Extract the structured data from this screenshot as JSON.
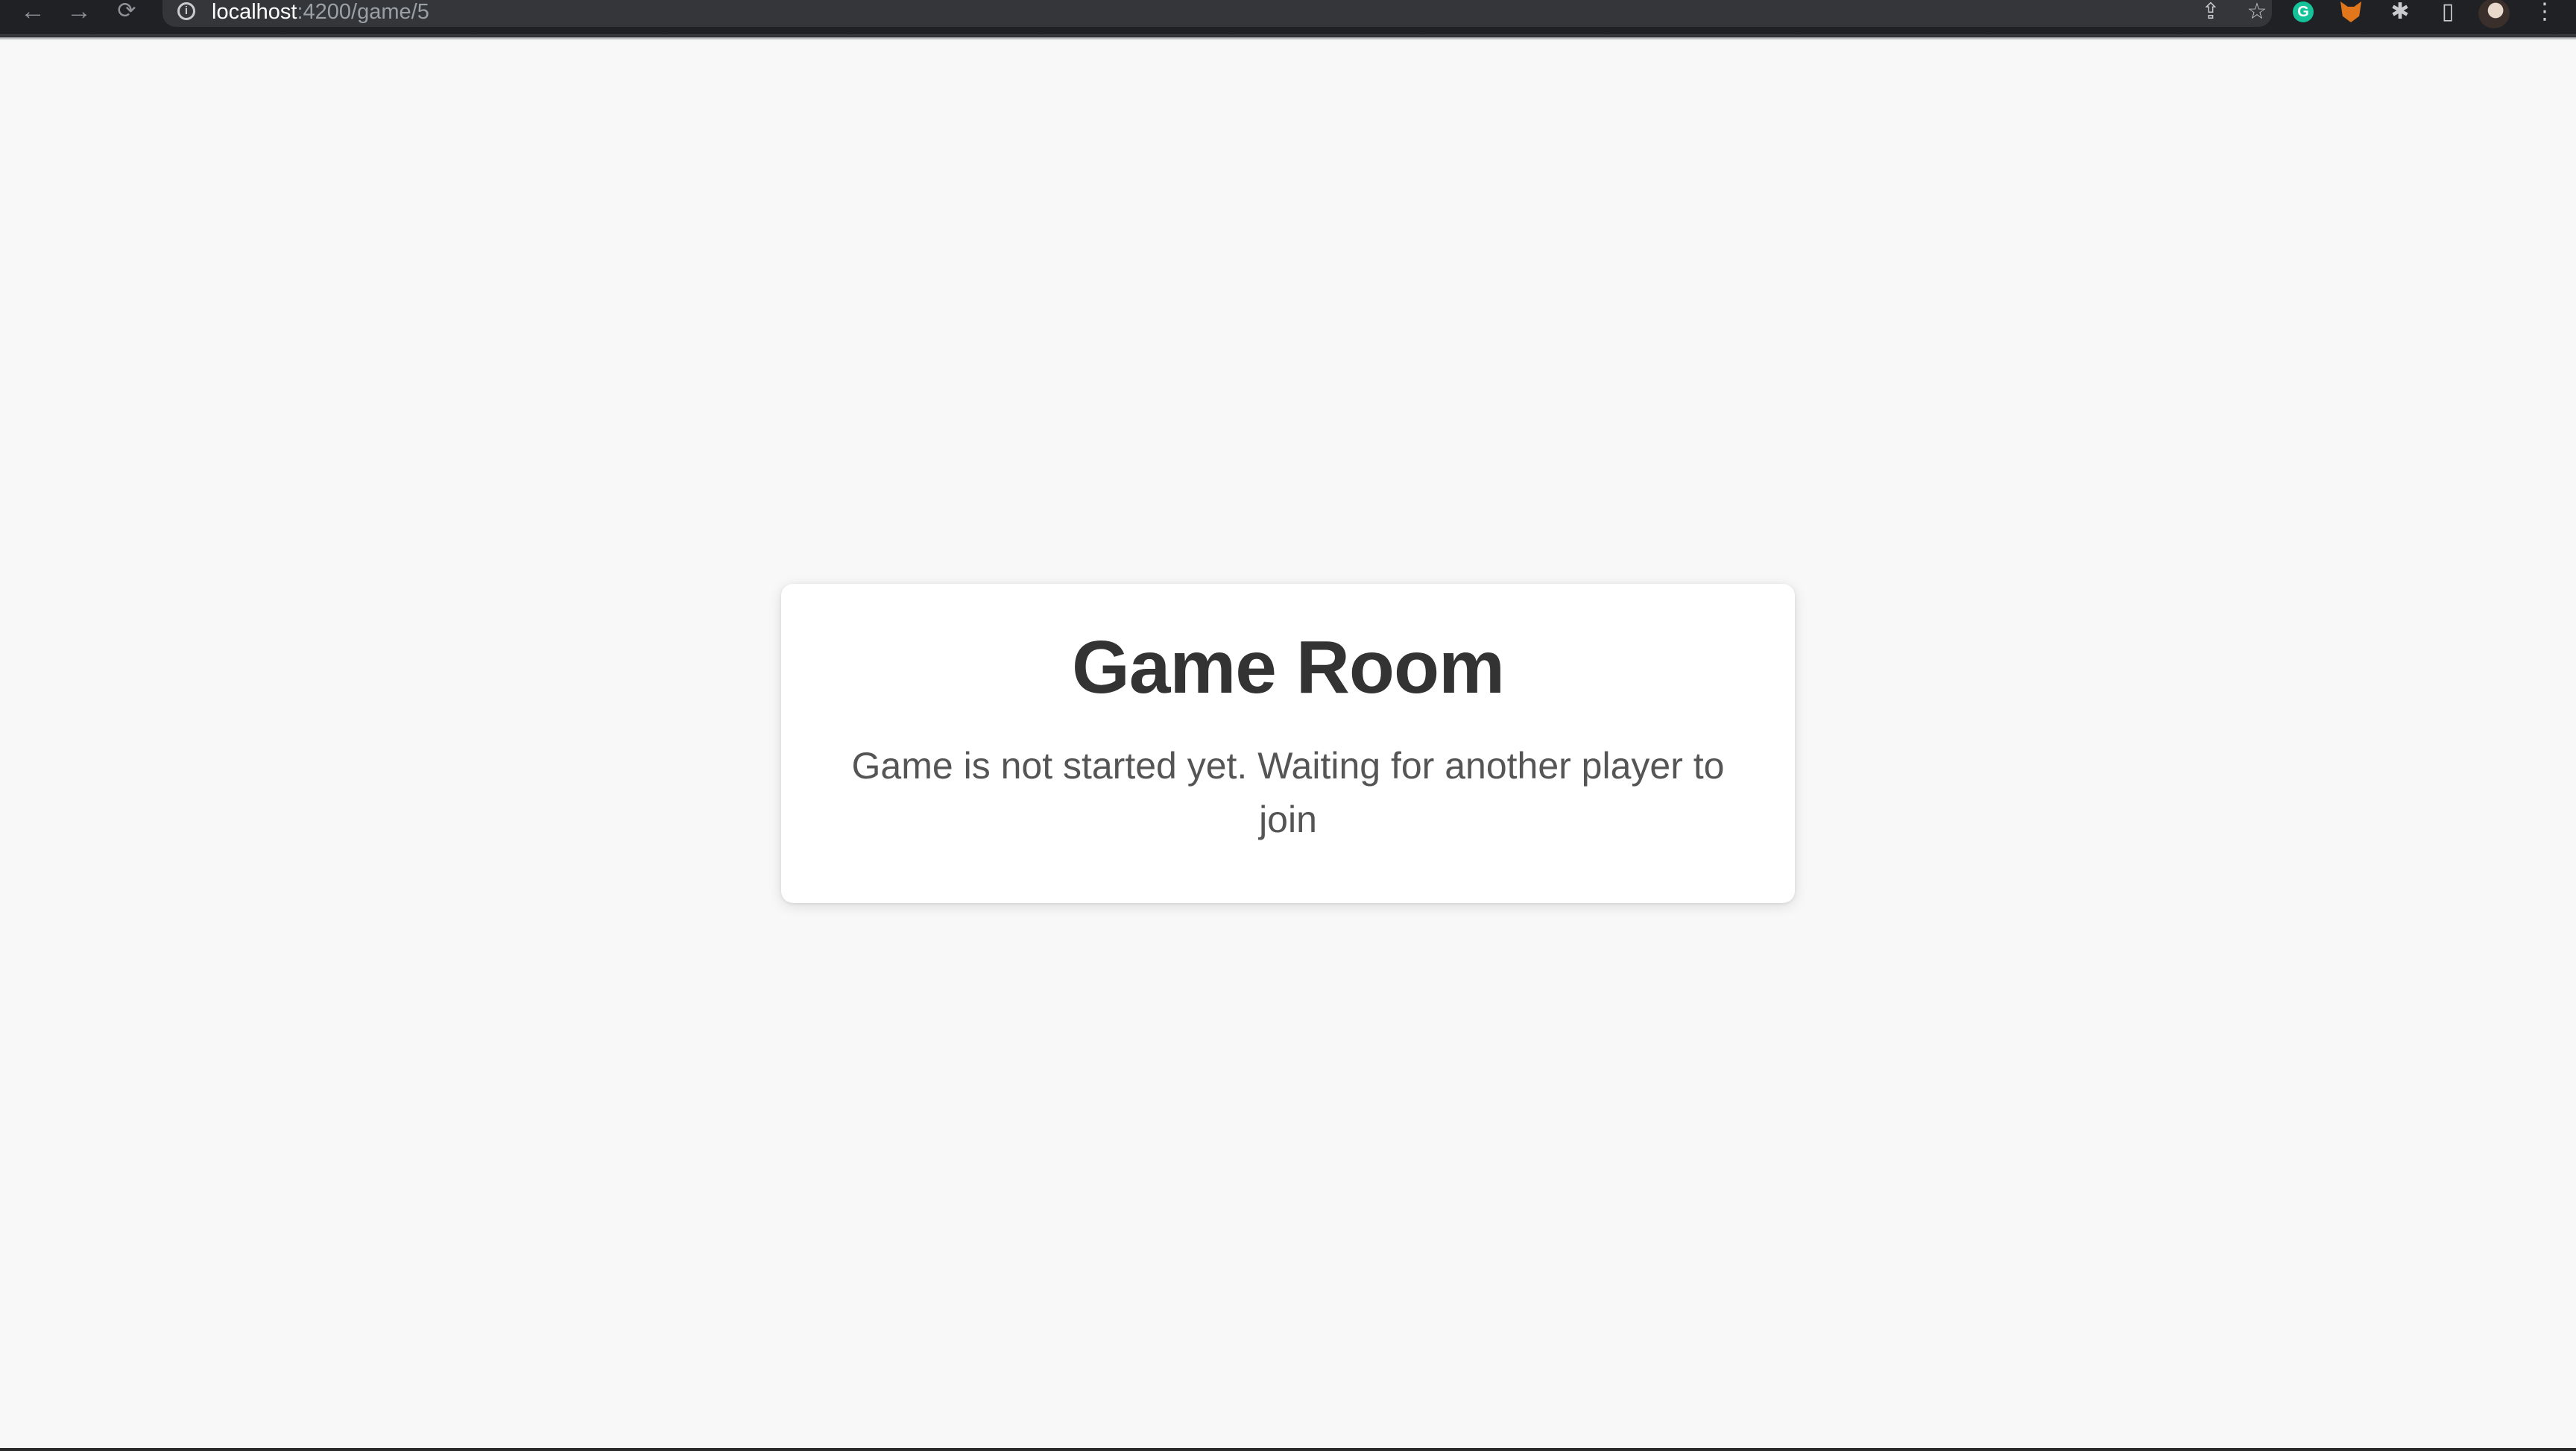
{
  "browser": {
    "url_host": "localhost",
    "url_path": ":4200/game/5",
    "icons": {
      "back": "arrow-left-icon",
      "forward": "arrow-right-icon",
      "reload": "reload-icon",
      "site_info": "info-icon",
      "share": "share-icon",
      "bookmark": "star-icon",
      "grammarly": "grammarly-icon",
      "metamask": "fox-icon",
      "extensions": "puzzle-icon",
      "side_panel": "side-panel-icon",
      "profile": "avatar",
      "menu": "kebab-menu-icon"
    }
  },
  "card": {
    "title": "Game Room",
    "message": "Game is not started yet. Waiting for another player to join"
  },
  "colors": {
    "page_background": "#f8f8f8",
    "toolbar": "#202124",
    "omnibox": "#35363a",
    "title": "#333333",
    "message": "#555555",
    "grammarly": "#15c39a"
  }
}
